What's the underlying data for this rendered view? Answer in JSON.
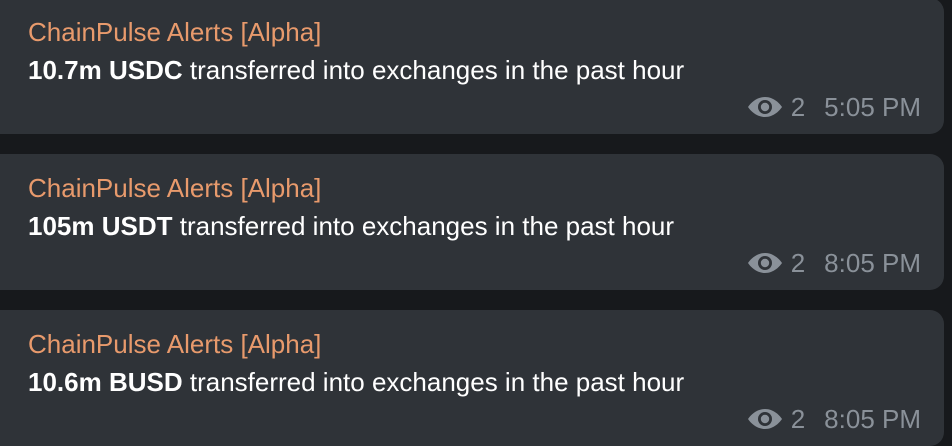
{
  "messages": [
    {
      "sender": "ChainPulse Alerts [Alpha]",
      "amount": "10.7m USDC",
      "text": " transferred into exchanges in the past hour",
      "views": "2",
      "time": "5:05 PM"
    },
    {
      "sender": "ChainPulse Alerts [Alpha]",
      "amount": "105m USDT",
      "text": " transferred into exchanges in the past hour",
      "views": "2",
      "time": "8:05 PM"
    },
    {
      "sender": "ChainPulse Alerts [Alpha]",
      "amount": "10.6m BUSD",
      "text": " transferred into exchanges in the past hour",
      "views": "2",
      "time": "8:05 PM"
    }
  ],
  "icons": {
    "views": "eye-icon"
  },
  "colors": {
    "sender": "#e89a6c",
    "bubble": "#2f3338",
    "background": "#17191c",
    "meta": "#8a9199",
    "text": "#ffffff"
  }
}
